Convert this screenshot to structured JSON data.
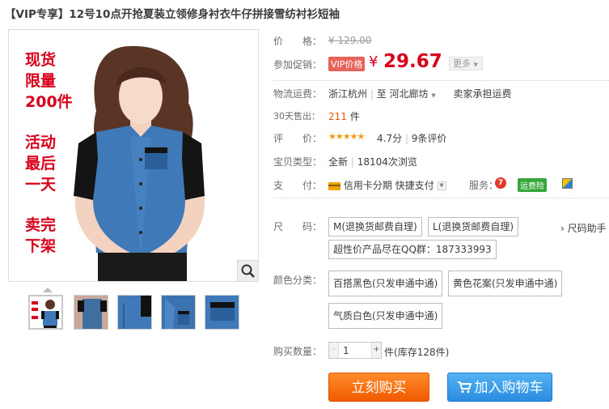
{
  "product": {
    "title": "【VIP专享】12号10点开抢夏装立领修身衬衣牛仔拼接雪纺衬衫短袖",
    "promo_lines": [
      "现货",
      "限量",
      "200件",
      "",
      "活动",
      "最后",
      "一天",
      "",
      "卖完",
      "下架"
    ]
  },
  "price": {
    "label": "价　　格：",
    "original": "¥ 129.00"
  },
  "promo": {
    "label": "参加促销：",
    "vip_badge": "VIP价格",
    "currency": "¥",
    "value": "29.67",
    "more_label": "更多"
  },
  "shipping": {
    "label": "物流运费：",
    "from": "浙江杭州",
    "to_sep": "至",
    "to": "河北廊坊",
    "fee_note": "卖家承担运费"
  },
  "sales": {
    "label": "30天售出：",
    "count": "211",
    "unit": "件"
  },
  "rating": {
    "label": "评　　价：",
    "stars": "★★★★★",
    "score": "4.7分",
    "reviews": "9条评价"
  },
  "type": {
    "label": "宝贝类型：",
    "condition": "全新",
    "views": "18104次浏览"
  },
  "payment": {
    "label": "支　　付：",
    "credit": "信用卡分期",
    "quick": "快捷支付",
    "service_label": "服务：",
    "service_badge": "运费险"
  },
  "size": {
    "label": "尺　　码：",
    "options": [
      "M(退换货邮费自理)",
      "L(退换货邮费自理)",
      "超性价产品尽在QQ群：187333993"
    ],
    "helper": "尺码助手"
  },
  "color": {
    "label": "颜色分类：",
    "options": [
      "百搭黑色(只发申通中通)",
      "黄色花案(只发申通中通)",
      "气质白色(只发申通中通)"
    ]
  },
  "quantity": {
    "label": "购买数量：",
    "value": "1",
    "minus": "-",
    "plus": "+",
    "unit": "件",
    "stock": "(库存128件)"
  },
  "actions": {
    "buy": "立刻购买",
    "cart": "加入购物车"
  },
  "colors": {
    "price_red": "#d8001a",
    "buy_orange": "#f15a00",
    "cart_blue": "#2a8ce1",
    "sales_orange": "#e35c00"
  }
}
